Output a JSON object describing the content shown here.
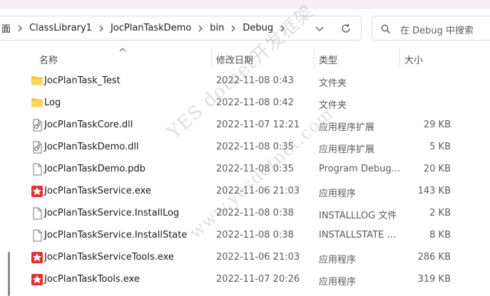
{
  "address": {
    "crumbs": [
      "面",
      "ClassLibrary1",
      "JocPlanTaskDemo",
      "bin",
      "Debug"
    ]
  },
  "search": {
    "placeholder": "在 Debug 中搜索"
  },
  "columns": {
    "name": "名称",
    "date": "修改日期",
    "type": "类型",
    "size": "大小"
  },
  "files": [
    {
      "name": "JocPlanTask_Test",
      "date": "2022-11-08 0:43",
      "type": "文件夹",
      "size": "",
      "icon": "folder-icon"
    },
    {
      "name": "Log",
      "date": "2022-11-08 0:42",
      "type": "文件夹",
      "size": "",
      "icon": "folder-icon"
    },
    {
      "name": "JocPlanTaskCore.dll",
      "date": "2022-11-07 12:21",
      "type": "应用程序扩展",
      "size": "29 KB",
      "icon": "dll-file-icon"
    },
    {
      "name": "JocPlanTaskDemo.dll",
      "date": "2022-11-08 0:35",
      "type": "应用程序扩展",
      "size": "5 KB",
      "icon": "dll-file-icon"
    },
    {
      "name": "JocPlanTaskDemo.pdb",
      "date": "2022-11-08 0:35",
      "type": "Program Debug...",
      "size": "20 KB",
      "icon": "blank-file-icon"
    },
    {
      "name": "JocPlanTaskService.exe",
      "date": "2022-11-06 21:03",
      "type": "应用程序",
      "size": "143 KB",
      "icon": "exe-app-icon"
    },
    {
      "name": "JocPlanTaskService.InstallLog",
      "date": "2022-11-08 0:38",
      "type": "INSTALLLOG 文件",
      "size": "2 KB",
      "icon": "blank-file-icon"
    },
    {
      "name": "JocPlanTaskService.InstallState",
      "date": "2022-11-08 0:38",
      "type": "INSTALLSTATE ...",
      "size": "8 KB",
      "icon": "blank-file-icon"
    },
    {
      "name": "JocPlanTaskServiceTools.exe",
      "date": "2022-11-06 21:03",
      "type": "应用程序",
      "size": "286 KB",
      "icon": "exe-app-icon"
    },
    {
      "name": "JocPlanTaskTools.exe",
      "date": "2022-11-07 20:26",
      "type": "应用程序",
      "size": "319 KB",
      "icon": "exe-app-icon"
    }
  ],
  "watermark": {
    "line1": "YES dotnet开发框架",
    "line2": "www.yesdotnet.com"
  },
  "colors": {
    "folder": "#f3c343",
    "exe_red": "#e5312d",
    "header_text": "#4a4a4a"
  }
}
